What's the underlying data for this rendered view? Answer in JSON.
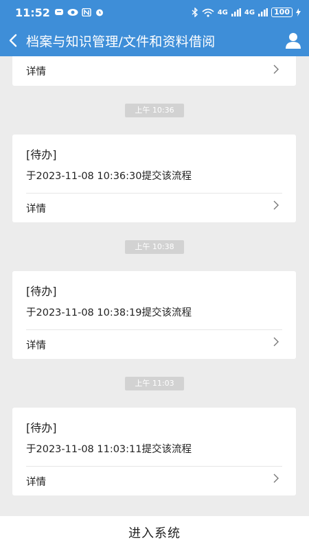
{
  "status": {
    "time": "11:52",
    "battery": "100",
    "signal1": "4G",
    "signal2": "4G"
  },
  "header": {
    "title": "档案与知识管理/文件和资料借阅"
  },
  "messages": [
    {
      "detail_label": "详情"
    },
    {
      "time": "上午 10:36",
      "tag": "[待办]",
      "text": "于2023-11-08 10:36:30提交该流程",
      "detail_label": "详情"
    },
    {
      "time": "上午 10:38",
      "tag": "[待办]",
      "text": "于2023-11-08 10:38:19提交该流程",
      "detail_label": "详情"
    },
    {
      "time": "上午 11:03",
      "tag": "[待办]",
      "text": "于2023-11-08 11:03:11提交该流程",
      "detail_label": "详情"
    }
  ],
  "footer": {
    "enter_label": "进入系统"
  },
  "colors": {
    "header_bg": "#3e8ed8",
    "page_bg": "#ececec",
    "badge_bg": "#d2d2d2"
  }
}
